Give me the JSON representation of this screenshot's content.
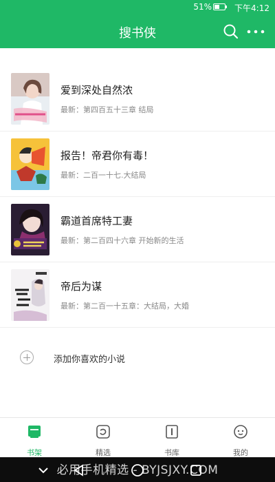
{
  "status_bar": {
    "battery": "51%",
    "battery_level": 0.51,
    "time": "下午4:12"
  },
  "app_bar": {
    "title": "搜书侠"
  },
  "books": [
    {
      "title": "爱到深处自然浓",
      "latest": "最新：第四百五十三章 结局"
    },
    {
      "title": "报告！帝君你有毒！",
      "latest": "最新：二百一十七.大结局"
    },
    {
      "title": "霸道首席特工妻",
      "latest": "最新：第二百四十六章 开始新的生活"
    },
    {
      "title": "帝后为谋",
      "latest": "最新：第二百一十五章：大结局，大婚"
    }
  ],
  "add_book": {
    "label": "添加你喜欢的小说"
  },
  "tabs": [
    {
      "label": "书架",
      "icon": "bookshelf-icon",
      "active": true
    },
    {
      "label": "精选",
      "icon": "featured-icon",
      "active": false
    },
    {
      "label": "书库",
      "icon": "library-icon",
      "active": false
    },
    {
      "label": "我的",
      "icon": "profile-icon",
      "active": false
    }
  ],
  "watermark": "必用手机精选 - BYJSJXY.COM",
  "colors": {
    "accent": "#1fb866",
    "nav_bar": "#0d0d0d"
  }
}
